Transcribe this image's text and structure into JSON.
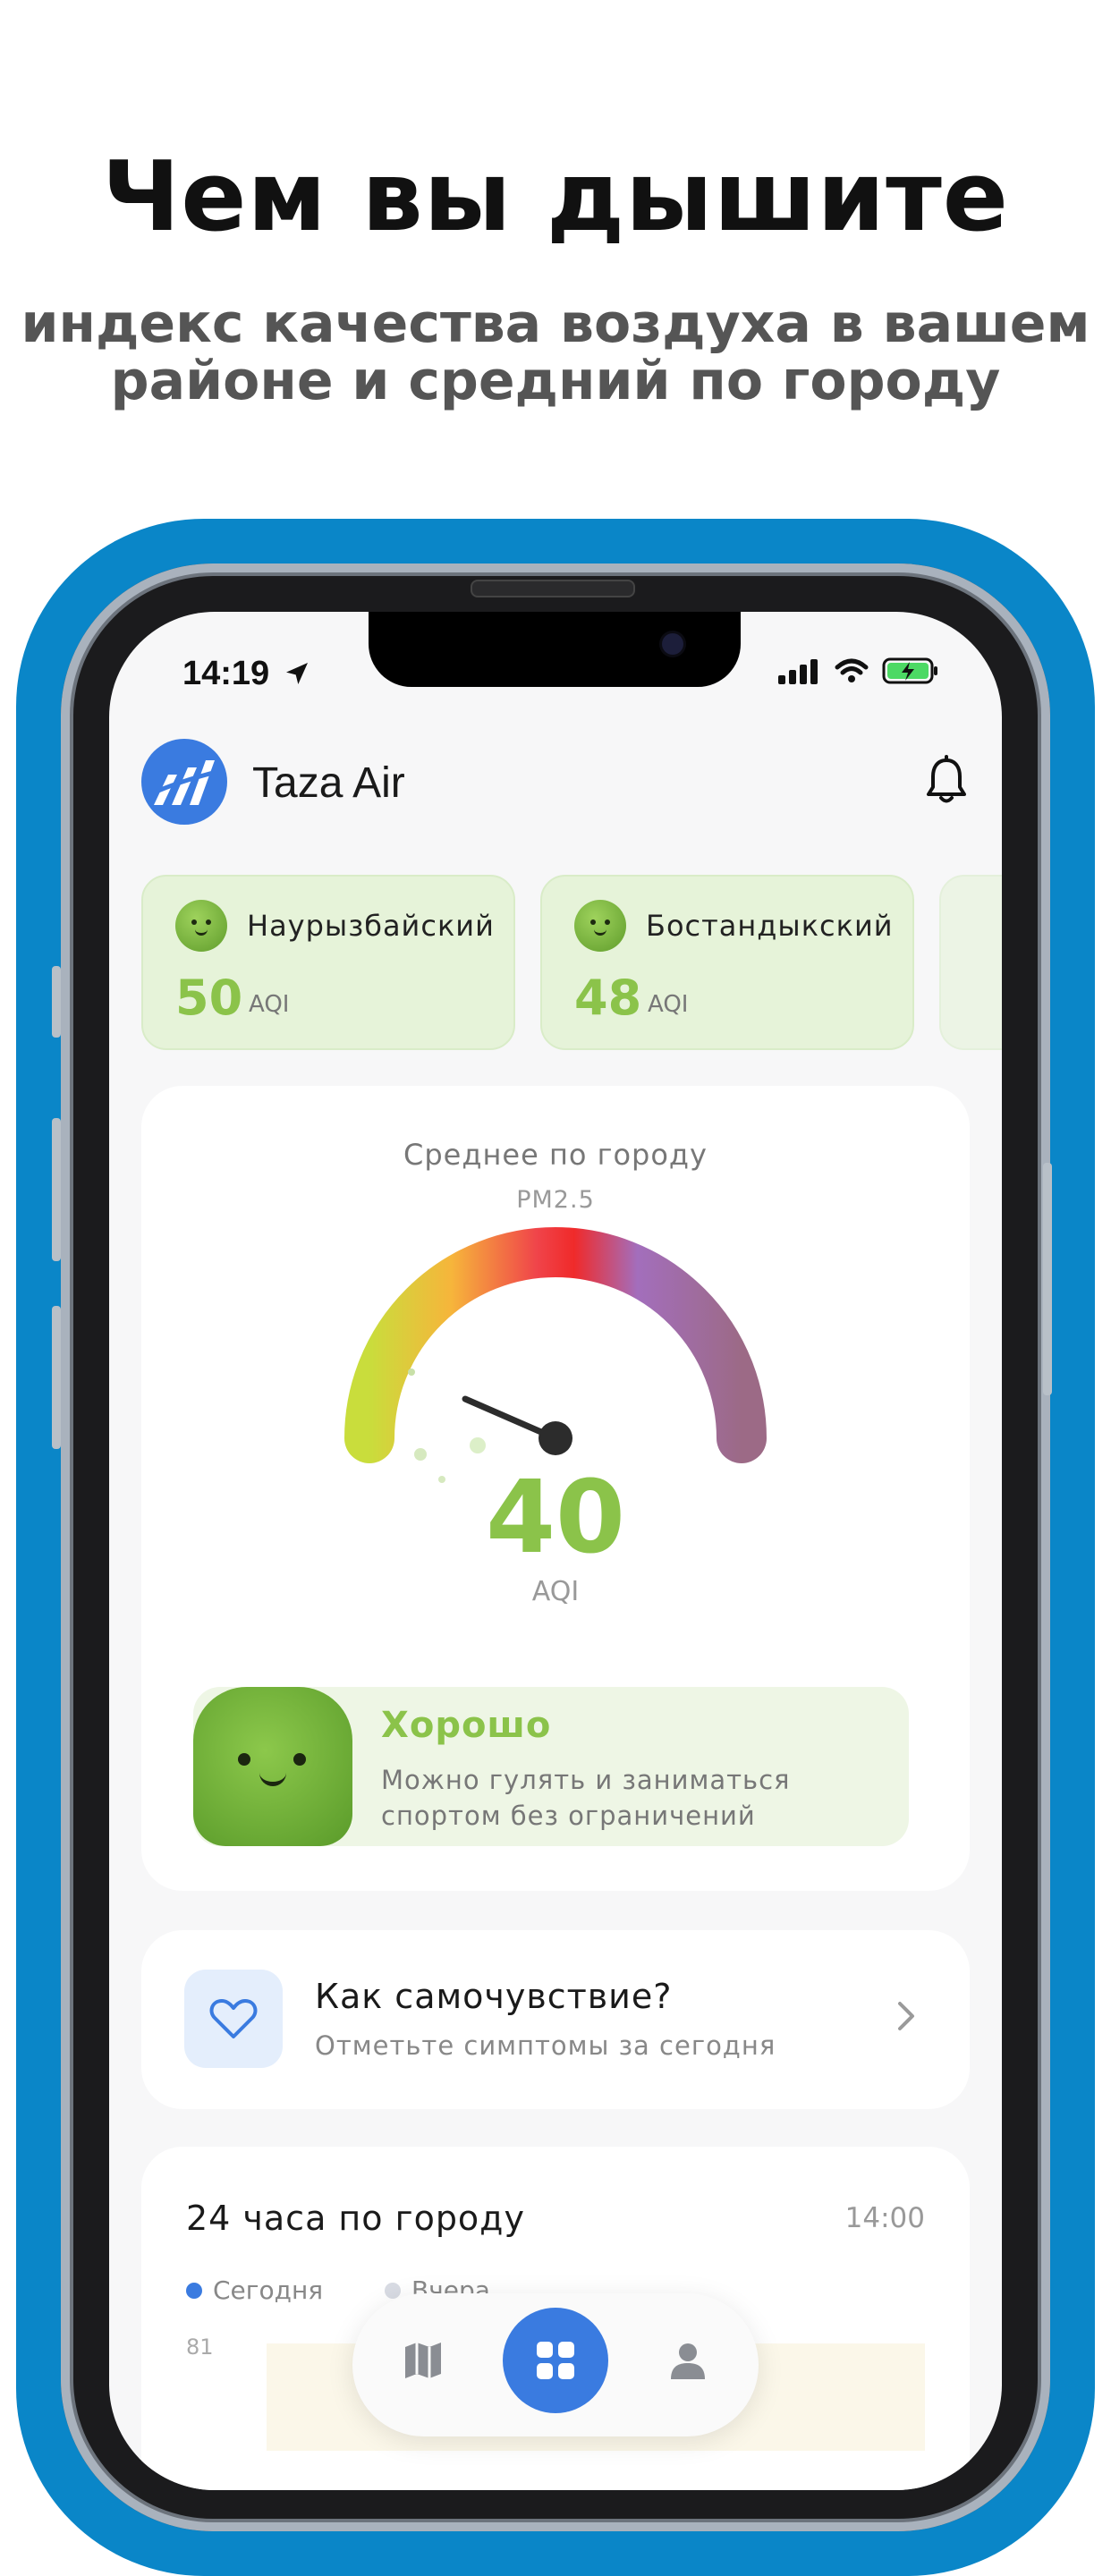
{
  "promo": {
    "headline": "Чем вы дышите",
    "subline_1": "индекс качества воздуха в вашем",
    "subline_2": "районе и средний по городу"
  },
  "status_bar": {
    "time": "14:19",
    "icons": [
      "location-arrow-icon",
      "cellular-signal-icon",
      "wifi-icon",
      "battery-charging-icon"
    ]
  },
  "header": {
    "app_name": "Taza Air",
    "logo_icon": "taza-air-logo",
    "bell_icon": "bell-icon"
  },
  "districts": [
    {
      "name": "Наурызбайский",
      "value": "50",
      "unit": "AQI"
    },
    {
      "name": "Бостандыкский",
      "value": "48",
      "unit": "AQI"
    }
  ],
  "city_average": {
    "title": "Среднее по городу",
    "pollutant": "PM2.5",
    "value": "40",
    "unit": "AQI",
    "gauge_fraction": 0.2,
    "colors": [
      "#c9dd3c",
      "#f6b53b",
      "#f0444a",
      "#f02a2a",
      "#a36ebc",
      "#9c6a86"
    ]
  },
  "status": {
    "title": "Хорошо",
    "description": "Можно гулять и заниматься спортом без ограничений",
    "accent": "#8bc34a"
  },
  "feeling": {
    "title": "Как самочувствие?",
    "subtitle": "Отметьте симптомы за сегодня"
  },
  "day_chart": {
    "title": "24 часа по городу",
    "time": "14:00",
    "legend_today": "Сегодня",
    "legend_yesterday": "Вчера",
    "y_max_label": "81",
    "today_color": "#3a7be0",
    "yesterday_color": "#d8dbe3"
  },
  "nav": {
    "items": [
      "map-icon",
      "dashboard-grid-icon",
      "profile-icon"
    ],
    "active": "dashboard-grid-icon",
    "active_color": "#3a7be0"
  }
}
